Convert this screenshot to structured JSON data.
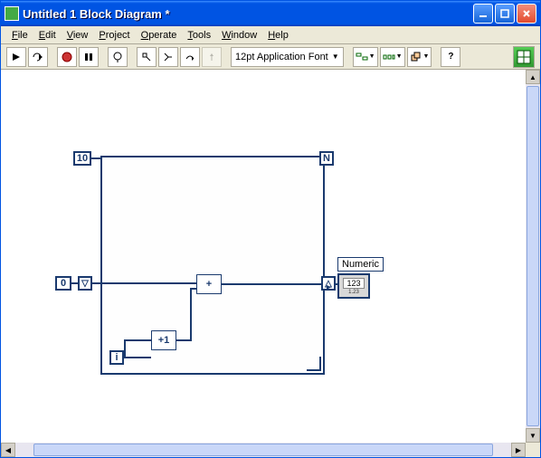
{
  "window": {
    "title": "Untitled 1 Block Diagram *"
  },
  "menu": {
    "file": "File",
    "edit": "Edit",
    "view": "View",
    "project": "Project",
    "operate": "Operate",
    "tools": "Tools",
    "window": "Window",
    "help": "Help"
  },
  "toolbar": {
    "font": "12pt Application Font"
  },
  "diagram": {
    "loop_N": "N",
    "loop_count": "10",
    "loop_i": "i",
    "shift_init": "0",
    "add_sym": "+",
    "inc_sym": "+1",
    "indicator_label": "Numeric",
    "indicator_val": "123",
    "indicator_sub": "1.23"
  }
}
